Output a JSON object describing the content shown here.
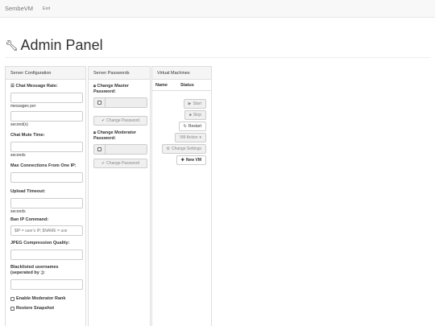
{
  "navbar": {
    "brand": "SembeVM",
    "exit": "Exit"
  },
  "page": {
    "title": "Admin Panel"
  },
  "server_config": {
    "heading": "Server Configuration",
    "chat_rate_label": "Chat Message Rate:",
    "messages_per": "messages per",
    "seconds_a": "second(s)",
    "mute_label": "Chat Mute Time:",
    "seconds_b": "seconds",
    "max_conn_label": "Max Connections From One IP:",
    "upload_label": "Upload Timeout:",
    "seconds_c": "seconds",
    "ban_label": "Ban IP Command:",
    "ban_placeholder": "$IP = user's IP, $NAME = use",
    "jpeg_label": "JPEG Compression Quality:",
    "blacklist_label": "Blacklisted usernames (seperated by ;):",
    "enable_mod": "Enable Moderator Rank",
    "restore_snapshot": "Restore Snapshot"
  },
  "passwords": {
    "heading": "Server Passwords",
    "master_label": "Change Master Password:",
    "master_button": "Change Password",
    "mod_label": "Change Moderator Password:",
    "mod_button": "Change Password"
  },
  "vms": {
    "heading": "Virtual Machines",
    "col_name": "Name",
    "col_status": "Status",
    "start": "Start",
    "stop": "Stop",
    "restart": "Restart",
    "vm_action": "VM Action",
    "change_settings": "Change Settings",
    "new_vm": "New VM"
  }
}
